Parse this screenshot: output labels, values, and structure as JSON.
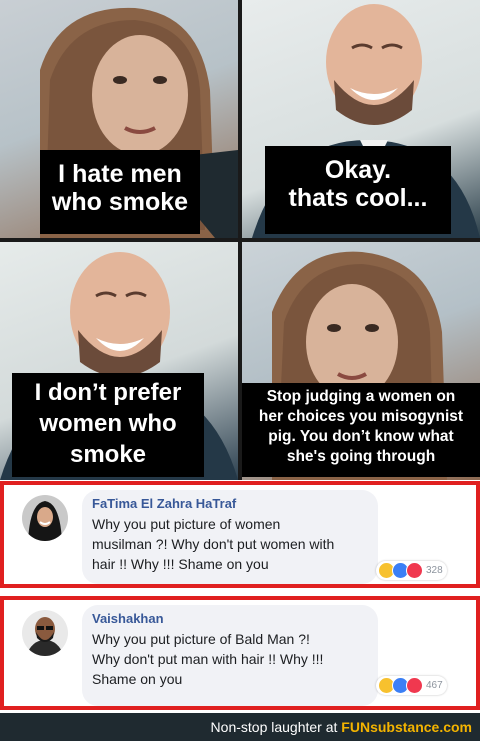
{
  "meme": {
    "captions": [
      "I hate men\nwho smoke",
      "Okay.\nthats cool...",
      "I don’t prefer\nwomen who\nsmoke",
      "Stop judging a women on\nher choices you misogynist\npig. You don’t know what\nshe's going through"
    ],
    "panels": [
      "woman-in-hijab",
      "laughing-bald-man",
      "laughing-bald-man",
      "woman-in-hijab"
    ]
  },
  "comments": [
    {
      "name": "FaTima El Zahra HaTraf",
      "text": "Why you put picture of women\nmusilman ?! Why don't put women with\nhair !! Why !!! Shame on you",
      "reaction_count": "328",
      "reactions": [
        "haha",
        "like",
        "love"
      ]
    },
    {
      "name": "Vaishakhan",
      "text": "Why you put picture of Bald Man ?!\nWhy don't put man with hair !! Why !!!\nShame on you",
      "reaction_count": "467",
      "reactions": [
        "haha",
        "like",
        "love"
      ]
    }
  ],
  "footer": {
    "prefix": "Non-stop laughter at",
    "brand": "FUNsubstance.com"
  },
  "colors": {
    "highlight_border": "#e02020",
    "name_link": "#385898",
    "footer_bg": "#1f2a30",
    "brand": "#f4b400"
  }
}
